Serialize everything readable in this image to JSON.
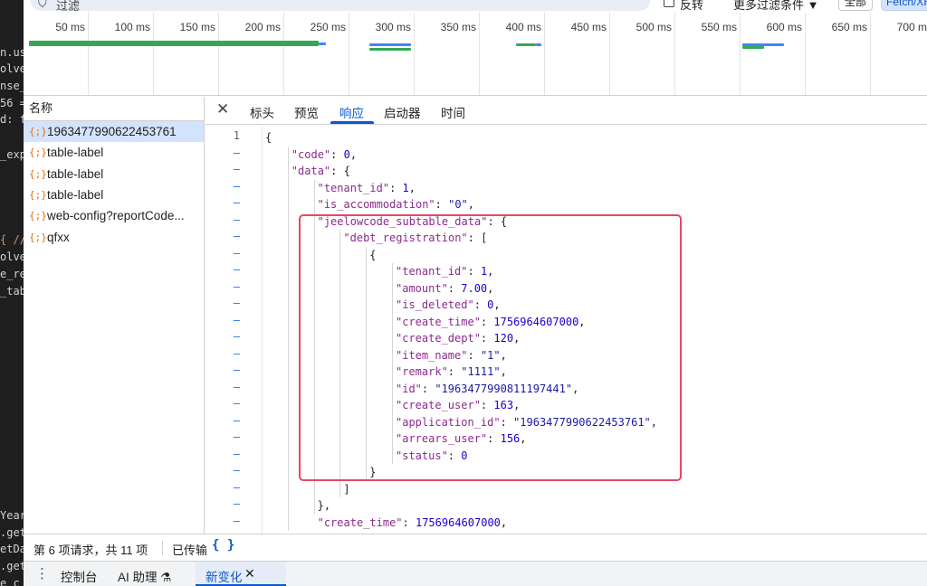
{
  "code_strip": {
    "fragments": [
      "n.us",
      "olve",
      "nse_",
      "56 =",
      "d: f",
      "_exp",
      "{ //",
      "olve",
      "e_re",
      "_tab",
      "Year",
      ".get",
      "etDa",
      ".get",
      "e c"
    ]
  },
  "filter_bar": {
    "filter_icon": "filter-icon",
    "placeholder": "过滤",
    "invert_label": "反转",
    "more_filters_label": "更多过滤条件 ▼",
    "all_button": "全部",
    "fetch_button": "Fetch/XHR"
  },
  "timeline": {
    "ticks": [
      "50 ms",
      "100 ms",
      "150 ms",
      "200 ms",
      "250 ms",
      "300 ms",
      "350 ms",
      "400 ms",
      "450 ms",
      "500 ms",
      "550 ms",
      "600 ms",
      "650 ms",
      "700 ms"
    ],
    "colors": {
      "waiting": "#34a853",
      "download": "#4285f4"
    }
  },
  "requests": {
    "header": "名称",
    "items": [
      {
        "icon": "{;}",
        "name": "1963477990622453761",
        "selected": true
      },
      {
        "icon": "{;}",
        "name": "table-label",
        "selected": false
      },
      {
        "icon": "{;}",
        "name": "table-label",
        "selected": false
      },
      {
        "icon": "{;}",
        "name": "table-label",
        "selected": false
      },
      {
        "icon": "{;}",
        "name": "web-config?reportCode...",
        "selected": false
      },
      {
        "icon": "{;}",
        "name": "qfxx",
        "selected": false
      }
    ]
  },
  "detail": {
    "close_icon": "close-icon",
    "tabs": [
      "标头",
      "预览",
      "响应",
      "启动器",
      "时间"
    ],
    "active_tab": "响应",
    "first_line_number": "1",
    "dash": "–",
    "lines": [
      [
        [
          "p",
          "{"
        ]
      ],
      [
        [
          "k",
          "\"code\""
        ],
        [
          "p",
          ": "
        ],
        [
          "n",
          "0"
        ],
        [
          "p",
          ","
        ]
      ],
      [
        [
          "k",
          "\"data\""
        ],
        [
          "p",
          ": {"
        ]
      ],
      [
        [
          "k",
          "\"tenant_id\""
        ],
        [
          "p",
          ": "
        ],
        [
          "n",
          "1"
        ],
        [
          "p",
          ","
        ]
      ],
      [
        [
          "k",
          "\"is_accommodation\""
        ],
        [
          "p",
          ": "
        ],
        [
          "s",
          "\"0\""
        ],
        [
          "p",
          ","
        ]
      ],
      [
        [
          "k",
          "\"jeelowcode_subtable_data\""
        ],
        [
          "p",
          ": {"
        ]
      ],
      [
        [
          "k",
          "\"debt_registration\""
        ],
        [
          "p",
          ": ["
        ]
      ],
      [
        [
          "p",
          "{"
        ]
      ],
      [
        [
          "k",
          "\"tenant_id\""
        ],
        [
          "p",
          ": "
        ],
        [
          "n",
          "1"
        ],
        [
          "p",
          ","
        ]
      ],
      [
        [
          "k",
          "\"amount\""
        ],
        [
          "p",
          ": "
        ],
        [
          "n",
          "7.00"
        ],
        [
          "p",
          ","
        ]
      ],
      [
        [
          "k",
          "\"is_deleted\""
        ],
        [
          "p",
          ": "
        ],
        [
          "n",
          "0"
        ],
        [
          "p",
          ","
        ]
      ],
      [
        [
          "k",
          "\"create_time\""
        ],
        [
          "p",
          ": "
        ],
        [
          "n",
          "1756964607000"
        ],
        [
          "p",
          ","
        ]
      ],
      [
        [
          "k",
          "\"create_dept\""
        ],
        [
          "p",
          ": "
        ],
        [
          "n",
          "120"
        ],
        [
          "p",
          ","
        ]
      ],
      [
        [
          "k",
          "\"item_name\""
        ],
        [
          "p",
          ": "
        ],
        [
          "s",
          "\"1\""
        ],
        [
          "p",
          ","
        ]
      ],
      [
        [
          "k",
          "\"remark\""
        ],
        [
          "p",
          ": "
        ],
        [
          "s",
          "\"1111\""
        ],
        [
          "p",
          ","
        ]
      ],
      [
        [
          "k",
          "\"id\""
        ],
        [
          "p",
          ": "
        ],
        [
          "s",
          "\"1963477990811197441\""
        ],
        [
          "p",
          ","
        ]
      ],
      [
        [
          "k",
          "\"create_user\""
        ],
        [
          "p",
          ": "
        ],
        [
          "n",
          "163"
        ],
        [
          "p",
          ","
        ]
      ],
      [
        [
          "k",
          "\"application_id\""
        ],
        [
          "p",
          ": "
        ],
        [
          "s",
          "\"1963477990622453761\""
        ],
        [
          "p",
          ","
        ]
      ],
      [
        [
          "k",
          "\"arrears_user\""
        ],
        [
          "p",
          ": "
        ],
        [
          "n",
          "156"
        ],
        [
          "p",
          ","
        ]
      ],
      [
        [
          "k",
          "\"status\""
        ],
        [
          "p",
          ": "
        ],
        [
          "n",
          "0"
        ]
      ],
      [
        [
          "p",
          "}"
        ]
      ],
      [
        [
          "p",
          "]"
        ]
      ],
      [
        [
          "p",
          "},"
        ]
      ],
      [
        [
          "k",
          "\"create_time\""
        ],
        [
          "p",
          ": "
        ],
        [
          "n",
          "1756964607000"
        ],
        [
          "p",
          ","
        ]
      ]
    ]
  },
  "statusbar": {
    "summary": "第 6 项请求，共 11 项",
    "transferred": "已传输",
    "pretty_print_icon": "{ }"
  },
  "drawer": {
    "menu_icon": "⋮",
    "tabs": [
      "控制台",
      "AI 助理 ⚗",
      "新变化"
    ],
    "active_tab": "新变化",
    "close_icon": "✕"
  },
  "highlight_color": "#e74864"
}
